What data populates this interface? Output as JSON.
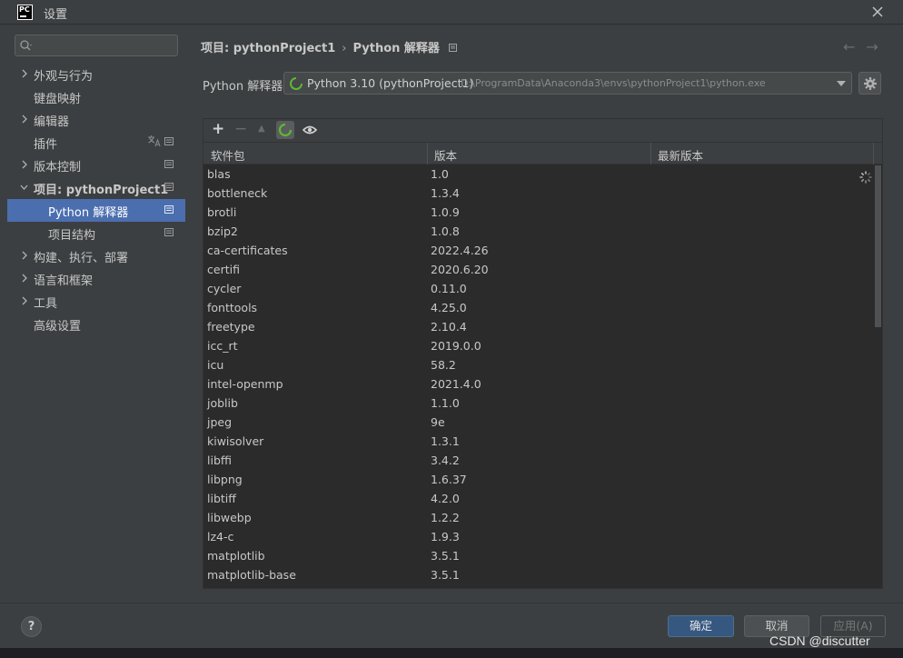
{
  "window": {
    "app_logo": "PC",
    "title": "设置"
  },
  "search": {
    "placeholder": ""
  },
  "sidebar": {
    "items": [
      {
        "label": "外观与行为",
        "expandable": true
      },
      {
        "label": "键盘映射",
        "expandable": false
      },
      {
        "label": "编辑器",
        "expandable": true
      },
      {
        "label": "插件",
        "expandable": false
      },
      {
        "label": "版本控制",
        "expandable": true
      },
      {
        "label": "项目: pythonProject1",
        "expandable": true,
        "expanded": true
      },
      {
        "label": "Python 解释器",
        "selected": true
      },
      {
        "label": "项目结构"
      },
      {
        "label": "构建、执行、部署",
        "expandable": true
      },
      {
        "label": "语言和框架",
        "expandable": true
      },
      {
        "label": "工具",
        "expandable": true
      },
      {
        "label": "高级设置",
        "expandable": false
      }
    ]
  },
  "breadcrumb": {
    "parent": "项目: pythonProject1",
    "separator": "›",
    "current": "Python 解释器"
  },
  "nav": {
    "back": "←",
    "forward": "→"
  },
  "interpreter": {
    "label": "Python 解释器:",
    "name": "Python 3.10 (pythonProject1)",
    "path": "D:\\ProgramData\\Anaconda3\\envs\\pythonProject1\\python.exe"
  },
  "toolbar": {
    "add": "+",
    "remove": "−",
    "upgrade": "▲"
  },
  "table": {
    "columns": [
      "软件包",
      "版本",
      "最新版本"
    ],
    "rows": [
      [
        "blas",
        "1.0"
      ],
      [
        "bottleneck",
        "1.3.4"
      ],
      [
        "brotli",
        "1.0.9"
      ],
      [
        "bzip2",
        "1.0.8"
      ],
      [
        "ca-certificates",
        "2022.4.26"
      ],
      [
        "certifi",
        "2020.6.20"
      ],
      [
        "cycler",
        "0.11.0"
      ],
      [
        "fonttools",
        "4.25.0"
      ],
      [
        "freetype",
        "2.10.4"
      ],
      [
        "icc_rt",
        "2019.0.0"
      ],
      [
        "icu",
        "58.2"
      ],
      [
        "intel-openmp",
        "2021.4.0"
      ],
      [
        "joblib",
        "1.1.0"
      ],
      [
        "jpeg",
        "9e"
      ],
      [
        "kiwisolver",
        "1.3.1"
      ],
      [
        "libffi",
        "3.4.2"
      ],
      [
        "libpng",
        "1.6.37"
      ],
      [
        "libtiff",
        "4.2.0"
      ],
      [
        "libwebp",
        "1.2.2"
      ],
      [
        "lz4-c",
        "1.9.3"
      ],
      [
        "matplotlib",
        "3.5.1"
      ],
      [
        "matplotlib-base",
        "3.5.1"
      ]
    ]
  },
  "footer": {
    "help": "?",
    "ok": "确定",
    "cancel": "取消",
    "apply": "应用(A)"
  },
  "watermark": "CSDN @discutter",
  "colors": {
    "selection": "#4b6eaf",
    "primary_button": "#365880",
    "spinner": "#5fb832"
  }
}
